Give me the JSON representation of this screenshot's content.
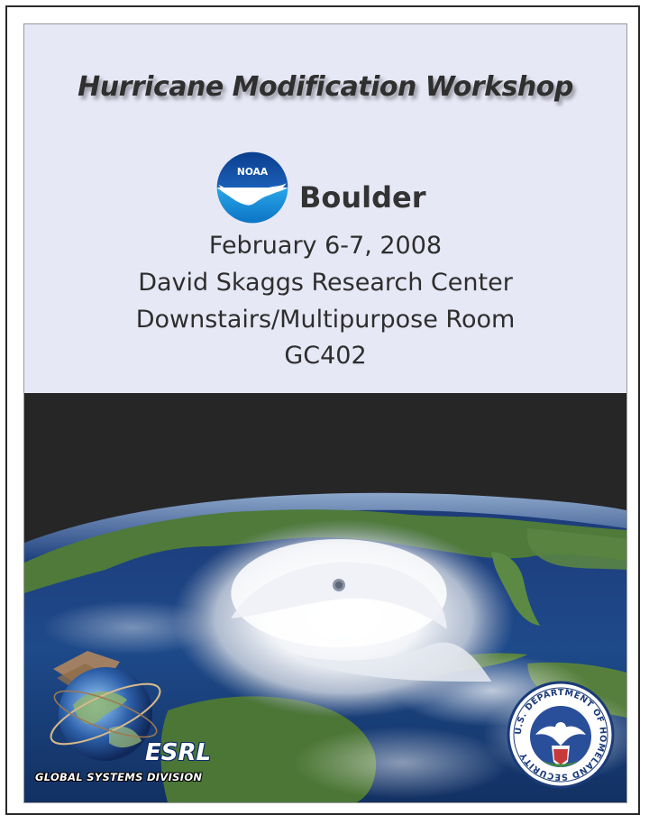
{
  "title": "Hurricane Modification Workshop",
  "location": {
    "city": "Boulder",
    "date": "February 6-7, 2008",
    "venue": "David Skaggs Research Center",
    "room": "Downstairs/Multipurpose Room",
    "room_code": "GC402"
  },
  "logos": {
    "noaa": {
      "text": "NOAA",
      "icon": "noaa-logo-icon"
    },
    "esrl": {
      "name": "ESRL",
      "division": "GLOBAL SYSTEMS DIVISION",
      "icon": "esrl-globe-icon"
    },
    "dhs": {
      "text": "U.S. DEPARTMENT OF HOMELAND SECURITY",
      "icon": "dhs-seal-icon"
    }
  },
  "colors": {
    "header_background": "#e7e8f6",
    "text": "#2e2e2e",
    "noaa_blue": "#1f6fc0",
    "space": "#262626"
  }
}
